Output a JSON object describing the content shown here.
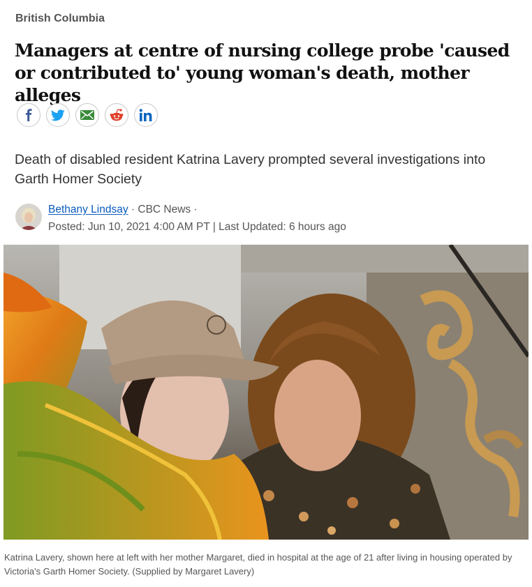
{
  "article": {
    "section": "British Columbia",
    "headline": "Managers at centre of nursing college probe 'caused or contributed to' young woman's death, mother alleges",
    "dek": "Death of disabled resident Katrina Lavery prompted several investigations into Garth Homer Society",
    "byline": {
      "author": "Bethany Lindsay",
      "sep1": " · ",
      "outlet": "CBC News",
      "sep2": " ·",
      "posted": "Posted: Jun 10, 2021 4:00 AM PT | Last Updated: 6 hours ago"
    },
    "photo_caption": "Katrina Lavery, shown here at left with her mother Margaret, died in hospital at the age of 21 after living in housing operated by Victoria's Garth Homer Society. (Supplied by Margaret Lavery)"
  },
  "share_buttons": [
    {
      "icon": "facebook-icon",
      "color": "#3b5998"
    },
    {
      "icon": "twitter-icon",
      "color": "#1da1f2"
    },
    {
      "icon": "email-icon",
      "color": "#3a8a3a"
    },
    {
      "icon": "reddit-icon",
      "color": "#e0402a"
    },
    {
      "icon": "linkedin-icon",
      "color": "#0a66c2"
    }
  ],
  "colors": {
    "link": "#0a5bbd",
    "text": "#222222",
    "muted": "#555555"
  }
}
